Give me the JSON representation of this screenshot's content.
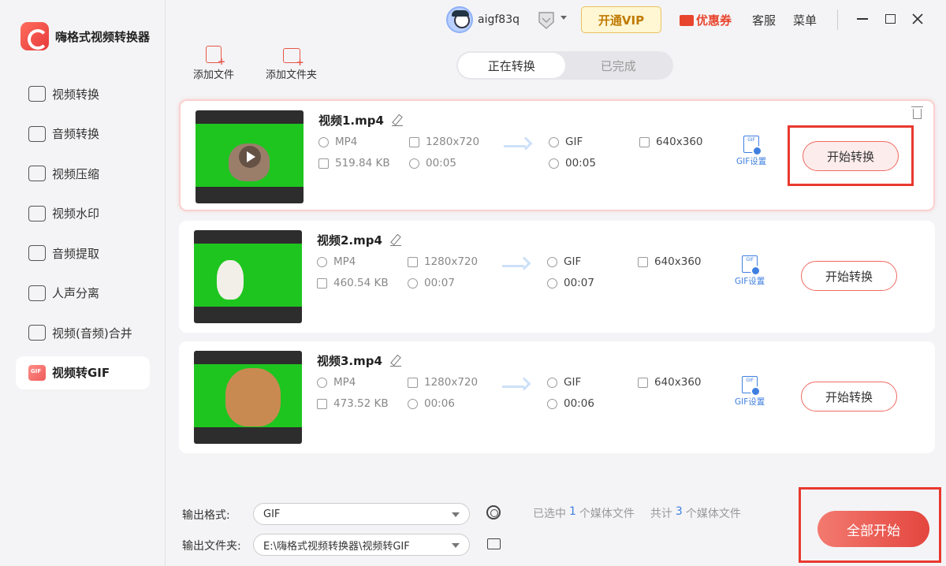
{
  "app": {
    "name": "嗨格式视频转换器"
  },
  "sidebar": {
    "items": [
      {
        "label": "视频转换",
        "icon": "video-convert-icon"
      },
      {
        "label": "音频转换",
        "icon": "audio-convert-icon"
      },
      {
        "label": "视频压缩",
        "icon": "video-compress-icon"
      },
      {
        "label": "视频水印",
        "icon": "watermark-icon"
      },
      {
        "label": "音频提取",
        "icon": "audio-extract-icon"
      },
      {
        "label": "人声分离",
        "icon": "voice-separate-icon"
      },
      {
        "label": "视频(音频)合并",
        "icon": "merge-icon"
      },
      {
        "label": "视频转GIF",
        "icon": "gif-icon",
        "active": true
      }
    ]
  },
  "titlebar": {
    "username": "aigf83q",
    "vip_label": "开通VIP",
    "coupon_label": "优惠券",
    "service_label": "客服",
    "menu_label": "菜单"
  },
  "toolbar": {
    "add_file": "添加文件",
    "add_folder": "添加文件夹"
  },
  "tabs": [
    {
      "label": "正在转换",
      "active": true
    },
    {
      "label": "已完成",
      "active": false
    }
  ],
  "files": [
    {
      "name": "视频1.mp4",
      "src_format": "MP4",
      "src_res": "1280x720",
      "src_size": "519.84 KB",
      "src_dur": "00:05",
      "out_format": "GIF",
      "out_res": "640x360",
      "out_dur": "00:05",
      "gif_settings": "GIF设置",
      "convert_label": "开始转换"
    },
    {
      "name": "视频2.mp4",
      "src_format": "MP4",
      "src_res": "1280x720",
      "src_size": "460.54 KB",
      "src_dur": "00:07",
      "out_format": "GIF",
      "out_res": "640x360",
      "out_dur": "00:07",
      "gif_settings": "GIF设置",
      "convert_label": "开始转换"
    },
    {
      "name": "视频3.mp4",
      "src_format": "MP4",
      "src_res": "1280x720",
      "src_size": "473.52 KB",
      "src_dur": "00:06",
      "out_format": "GIF",
      "out_res": "640x360",
      "out_dur": "00:06",
      "gif_settings": "GIF设置",
      "convert_label": "开始转换"
    }
  ],
  "bottom": {
    "format_label": "输出格式:",
    "format_value": "GIF",
    "folder_label": "输出文件夹:",
    "folder_value": "E:\\嗨格式视频转换器\\视频转GIF",
    "selected_prefix": "已选中",
    "selected_count": "1",
    "selected_suffix": "个媒体文件",
    "total_prefix": "共计",
    "total_count": "3",
    "total_suffix": "个媒体文件",
    "start_all": "全部开始"
  },
  "colors": {
    "accent": "#e8452e",
    "link": "#3f7fe0",
    "vip": "#c07a00"
  }
}
